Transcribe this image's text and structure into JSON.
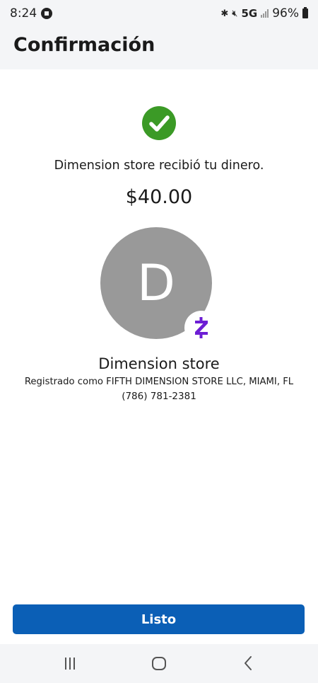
{
  "status_bar": {
    "time": "8:24",
    "network": "5G",
    "battery": "96%",
    "icons": [
      "chase-icon",
      "bluetooth-icon",
      "mute-icon",
      "signal-icon",
      "battery-icon"
    ]
  },
  "header": {
    "title": "Confirmación"
  },
  "confirmation": {
    "status_icon": "check-circle-icon",
    "message": "Dimension store recibió tu dinero.",
    "amount": "$40.00"
  },
  "recipient": {
    "avatar_initial": "D",
    "badge_icon": "zelle-icon",
    "name": "Dimension store",
    "registered_as": "Registrado como FIFTH DIMENSION STORE LLC, MIAMI, FL",
    "phone": "(786) 781-2381"
  },
  "actions": {
    "done_label": "Listo"
  },
  "nav_bar": {
    "buttons": [
      "recent-apps-icon",
      "home-icon",
      "back-icon"
    ]
  },
  "colors": {
    "success_green": "#3b9a26",
    "button_blue": "#0b5fb6",
    "avatar_gray": "#999999",
    "zelle_purple": "#6d1ed4",
    "header_background": "#f4f5f7"
  }
}
